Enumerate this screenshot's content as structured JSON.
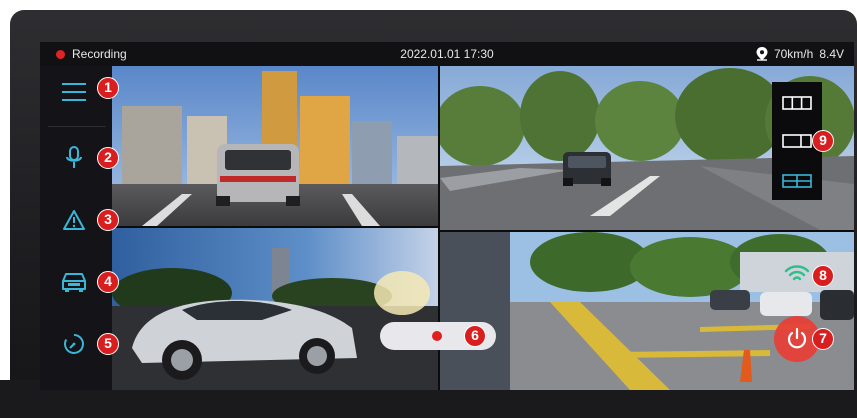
{
  "status_bar": {
    "recording_label": "Recording",
    "datetime": "2022.01.01 17:30",
    "speed": "70km/h",
    "voltage": "8.4V"
  },
  "sidebar": {
    "items": [
      {
        "name": "menu",
        "icon": "menu-icon",
        "badge": "1"
      },
      {
        "name": "voice",
        "icon": "microphone-icon",
        "badge": "2"
      },
      {
        "name": "event",
        "icon": "warning-icon",
        "badge": "3"
      },
      {
        "name": "parking",
        "icon": "car-icon",
        "badge": "4"
      },
      {
        "name": "timelapse",
        "icon": "timer-icon",
        "badge": "5"
      }
    ]
  },
  "controls": {
    "record_badge": "6",
    "power_badge": "7",
    "wifi_badge": "8",
    "layout_badge": "9"
  },
  "layout_options": [
    {
      "icon": "layout-three-split-icon",
      "selected": false
    },
    {
      "icon": "layout-two-split-icon",
      "selected": false
    },
    {
      "icon": "layout-quad-icon",
      "selected": true
    }
  ],
  "colors": {
    "accent": "#3ab7d8",
    "record": "#e02424",
    "badge": "#d81e1e",
    "wifi": "#2fbf8a"
  }
}
